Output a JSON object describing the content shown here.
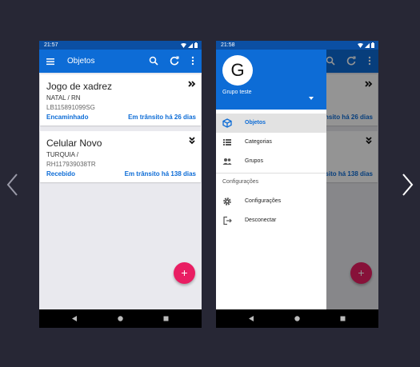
{
  "colors": {
    "primary": "#0d6cd6",
    "primary_dark": "#0b4fa3",
    "accent": "#e91e63",
    "background": "#272735"
  },
  "phone1": {
    "status_time": "21:57",
    "toolbar": {
      "title": "Objetos",
      "icons": [
        "menu-icon",
        "search-icon",
        "refresh-icon",
        "more-vert-icon"
      ]
    },
    "cards": [
      {
        "name": "Jogo de xadrez",
        "origin": "NATAL / RN",
        "code": "LB115891099SG",
        "status": "Encaminhado",
        "transit": "Em trânsito há 26 dias",
        "chevron": "double-chevron-right-icon"
      },
      {
        "name": "Celular Novo",
        "origin": "TURQUIA /",
        "code": "RH117939038TR",
        "status": "Recebido",
        "transit": "Em trânsito há 138 dias",
        "chevron": "double-chevron-down-icon"
      }
    ],
    "fab_label": "+"
  },
  "phone2": {
    "status_time": "21:58",
    "drawer": {
      "avatar_letter": "G",
      "group_name": "Grupo teste",
      "items": [
        {
          "label": "Objetos",
          "icon": "package-icon",
          "active": true
        },
        {
          "label": "Categorias",
          "icon": "list-icon",
          "active": false
        },
        {
          "label": "Grupos",
          "icon": "people-icon",
          "active": false
        }
      ],
      "section_label": "Configurações",
      "settings_items": [
        {
          "label": "Configurações",
          "icon": "gear-icon"
        },
        {
          "label": "Desconectar",
          "icon": "logout-icon"
        }
      ]
    },
    "background_transit_1": "Em trânsito há 26 dias",
    "background_transit_2": "Em trânsito há 138 dias",
    "fab_label": "+"
  }
}
